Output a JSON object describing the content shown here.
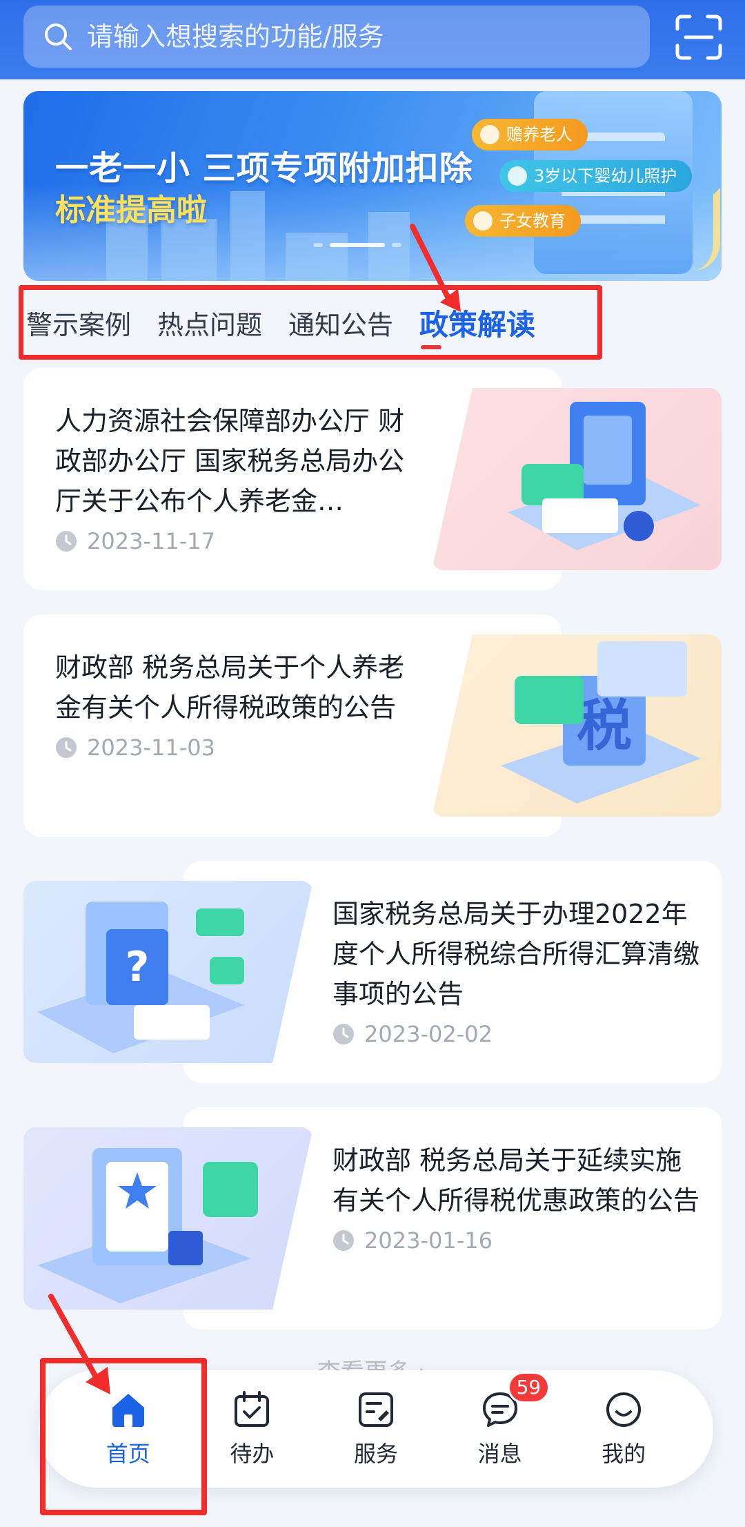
{
  "search": {
    "placeholder": "请输入想搜索的功能/服务",
    "search_icon": "search-icon",
    "scan_icon": "scan-icon"
  },
  "banner": {
    "title": "一老一小 三项专项附加扣除",
    "subtitle": "标准提高啦",
    "tags": [
      "赡养老人",
      "3岁以下婴幼儿照护",
      "子女教育"
    ]
  },
  "tabs": [
    {
      "label": "警示案例",
      "active": false
    },
    {
      "label": "热点问题",
      "active": false
    },
    {
      "label": "通知公告",
      "active": false
    },
    {
      "label": "政策解读",
      "active": true
    }
  ],
  "articles": [
    {
      "title": "人力资源社会保障部办公厅 财政部办公厅 国家税务总局办公厅关于公布个人养老金…",
      "date": "2023-11-17",
      "illustration": "document-folder-illustration"
    },
    {
      "title": "财政部 税务总局关于个人养老金有关个人所得税政策的公告",
      "date": "2023-11-03",
      "illustration": "tax-illustration"
    },
    {
      "title": "国家税务总局关于办理2022年度个人所得税综合所得汇算清缴事项的公告",
      "date": "2023-02-02",
      "illustration": "question-illustration"
    },
    {
      "title": "财政部 税务总局关于延续实施有关个人所得税优惠政策的公告",
      "date": "2023-01-16",
      "illustration": "certificate-illustration"
    }
  ],
  "more_label": "查看更多 ›",
  "bottom_nav": [
    {
      "label": "首页",
      "icon": "home-icon",
      "active": true
    },
    {
      "label": "待办",
      "icon": "calendar-check-icon",
      "active": false
    },
    {
      "label": "服务",
      "icon": "service-icon",
      "active": false
    },
    {
      "label": "消息",
      "icon": "message-icon",
      "active": false,
      "badge": "59"
    },
    {
      "label": "我的",
      "icon": "smile-icon",
      "active": false
    }
  ],
  "colors": {
    "primary": "#1a62e6",
    "header": "#2f6fe8",
    "annotation": "#f22b2b",
    "badge": "#f23a3a"
  }
}
